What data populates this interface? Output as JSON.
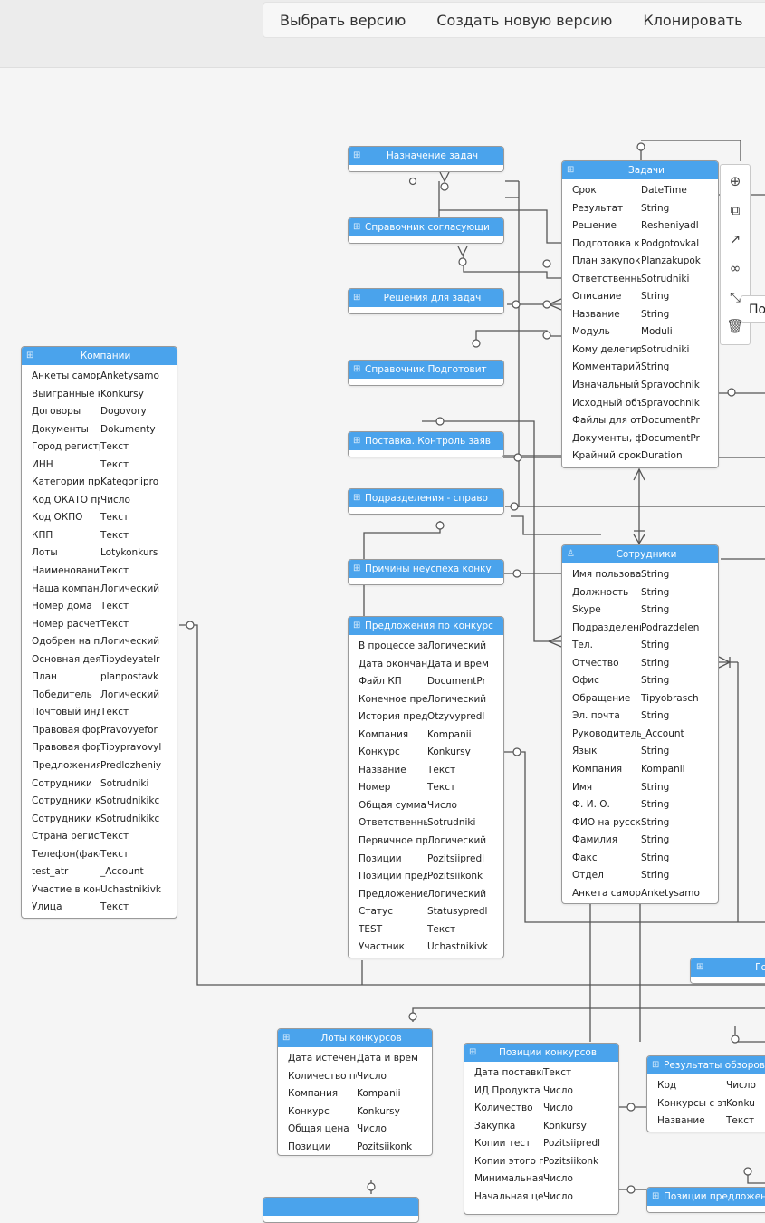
{
  "toolbar": {
    "select_version": "Выбрать версию",
    "new_version": "Создать новую версию",
    "clone": "Клонировать"
  },
  "tooltip": "По",
  "icons": {
    "table": "table-icon",
    "user": "user-icon",
    "tools": [
      "zoom-in-icon",
      "open-external-icon",
      "arrow-icon",
      "link-icon",
      "resize-icon",
      "trash-icon"
    ]
  },
  "colors": {
    "header": "#4aa3ec",
    "lines": "#555555"
  },
  "entities": [
    {
      "id": "naznachenie",
      "title": "Назначение задач",
      "fields": []
    },
    {
      "id": "spravochnik_sogl",
      "title": "Справочник согласующи",
      "fields": []
    },
    {
      "id": "resheniya",
      "title": "Решения для задач",
      "fields": []
    },
    {
      "id": "spravochnik_podg",
      "title": "Справочник Подготовит",
      "fields": []
    },
    {
      "id": "postavka",
      "title": "Поставка. Контроль заяв",
      "fields": []
    },
    {
      "id": "podrazdeleniya",
      "title": "Подразделения - справо",
      "fields": []
    },
    {
      "id": "prichiny",
      "title": "Причины неуспеха конку",
      "fields": []
    },
    {
      "id": "zadachi",
      "title": "Задачи",
      "fields": [
        [
          "Срок",
          "DateTime"
        ],
        [
          "Результат",
          "String"
        ],
        [
          "Решение",
          "Resheniyadl"
        ],
        [
          "Подготовка к",
          "Podgotovkal"
        ],
        [
          "План закупок",
          "Planzakupok"
        ],
        [
          "Ответственны",
          "Sotrudniki"
        ],
        [
          "Описание",
          "String"
        ],
        [
          "Название",
          "String"
        ],
        [
          "Модуль",
          "Moduli"
        ],
        [
          "Кому делегиро",
          "Sotrudniki"
        ],
        [
          "Комментарий",
          "String"
        ],
        [
          "Изначальный",
          "Spravochnik"
        ],
        [
          "Исходный объ",
          "Spravochnik"
        ],
        [
          "Файлы для от",
          "DocumentPr"
        ],
        [
          "Документы, ф",
          "DocumentPr"
        ],
        [
          "Крайний срок",
          "Duration"
        ]
      ]
    },
    {
      "id": "kompanii",
      "title": "Компании",
      "fields": [
        [
          "Анкеты самор",
          "Anketysamo"
        ],
        [
          "Выигранные к",
          "Konkursy"
        ],
        [
          "Договоры",
          "Dogovory"
        ],
        [
          "Документы",
          "Dokumenty"
        ],
        [
          "Город регистр",
          "Текст"
        ],
        [
          "ИНН",
          "Текст"
        ],
        [
          "Категории про",
          "Kategoriipro"
        ],
        [
          "Код ОКАТО пр",
          "Число"
        ],
        [
          "Код ОКПО",
          "Текст"
        ],
        [
          "КПП",
          "Текст"
        ],
        [
          "Лоты",
          "Lotykonkurs"
        ],
        [
          "Наименовани",
          "Текст"
        ],
        [
          "Наша компани",
          "Логический"
        ],
        [
          "Номер дома",
          "Текст"
        ],
        [
          "Номер расчет",
          "Текст"
        ],
        [
          "Одобрен на по",
          "Логический"
        ],
        [
          "Основная дея",
          "Tipydeyatelr"
        ],
        [
          "План",
          "planpostavk"
        ],
        [
          "Победитель",
          "Логический"
        ],
        [
          "Почтовый инд",
          "Текст"
        ],
        [
          "Правовая фор",
          "Pravovyefor"
        ],
        [
          "Правовая фор",
          "Tipypravovyl"
        ],
        [
          "Предложения",
          "Predlozheniy"
        ],
        [
          "Сотрудники",
          "Sotrudniki"
        ],
        [
          "Сотрудники ко",
          "Sotrudnikikc"
        ],
        [
          "Сотрудники ко",
          "Sotrudnikikc"
        ],
        [
          "Страна регист",
          "Текст"
        ],
        [
          "Телефон(факс",
          "Текст"
        ],
        [
          "test_atr",
          "_Account"
        ],
        [
          "Участие в кон",
          "Uchastnikivk"
        ],
        [
          "Улица",
          "Текст"
        ]
      ]
    },
    {
      "id": "predlozheniya",
      "title": "Предложения по конкурс",
      "fields": [
        [
          "В процессе за",
          "Логический"
        ],
        [
          "Дата окончан",
          "Дата и врем"
        ],
        [
          "Файл КП",
          "DocumentPr"
        ],
        [
          "Конечное пре",
          "Логический"
        ],
        [
          "История пред",
          "Otzyvypredl"
        ],
        [
          "Компания",
          "Kompanii"
        ],
        [
          "Конкурс",
          "Konkursy"
        ],
        [
          "Название",
          "Текст"
        ],
        [
          "Номер",
          "Текст"
        ],
        [
          "Общая сумма",
          "Число"
        ],
        [
          "Ответственны",
          "Sotrudniki"
        ],
        [
          "Первичное пр",
          "Логический"
        ],
        [
          "Позиции",
          "Pozitsiipredl"
        ],
        [
          "Позиции пред",
          "Pozitsiikonk"
        ],
        [
          "Предложение",
          "Логический"
        ],
        [
          "Статус",
          "Statusypredl"
        ],
        [
          "TEST",
          "Текст"
        ],
        [
          "Участник",
          "Uchastnikivk"
        ]
      ]
    },
    {
      "id": "sotrudniki",
      "title": "Сотрудники",
      "fields": [
        [
          "Имя пользова",
          "String"
        ],
        [
          "Должность",
          "String"
        ],
        [
          "Skype",
          "String"
        ],
        [
          "Подразделени",
          "Podrazdelen"
        ],
        [
          "Тел.",
          "String"
        ],
        [
          "Отчество",
          "String"
        ],
        [
          "Офис",
          "String"
        ],
        [
          "Обращение",
          "Tipyobrasch"
        ],
        [
          "Эл. почта",
          "String"
        ],
        [
          "Руководитель",
          "_Account"
        ],
        [
          "Язык",
          "String"
        ],
        [
          "Компания",
          "Kompanii"
        ],
        [
          "Имя",
          "String"
        ],
        [
          "Ф. И. О.",
          "String"
        ],
        [
          "ФИО на русск",
          "String"
        ],
        [
          "Фамилия",
          "String"
        ],
        [
          "Факс",
          "String"
        ],
        [
          "Отдел",
          "String"
        ],
        [
          "Анкета саморе",
          "Anketysamo"
        ]
      ]
    },
    {
      "id": "goro",
      "title": "Го",
      "fields": []
    },
    {
      "id": "loty",
      "title": "Лоты конкурсов",
      "fields": [
        [
          "Дата истечени",
          "Дата и врем"
        ],
        [
          "Количество по",
          "Число"
        ],
        [
          "Компания",
          "Kompanii"
        ],
        [
          "Конкурс",
          "Konkursy"
        ],
        [
          "Общая цена",
          "Число"
        ],
        [
          "Позиции",
          "Pozitsiikonk"
        ]
      ]
    },
    {
      "id": "pozitsii",
      "title": "Позиции конкурсов",
      "fields": [
        [
          "Дата поставки",
          "Текст"
        ],
        [
          "ИД Продукта",
          "Число"
        ],
        [
          "Количество",
          "Число"
        ],
        [
          "Закупка",
          "Konkursy"
        ],
        [
          "Копии тест",
          "Pozitsiipredl"
        ],
        [
          "Копии этого п",
          "Pozitsiikonk"
        ],
        [
          "Минимальная",
          "Число"
        ],
        [
          "Начальная це",
          "Число"
        ]
      ]
    },
    {
      "id": "rezultaty",
      "title": "Результаты обзоров",
      "fields": [
        [
          "Код",
          "Число"
        ],
        [
          "Конкурсы с эт",
          "Konku"
        ],
        [
          "Название",
          "Текст"
        ]
      ]
    },
    {
      "id": "pozitsii_pred",
      "title": "Позиции предложен",
      "fields": []
    },
    {
      "id": "bottom_node",
      "title": "",
      "fields": []
    }
  ]
}
